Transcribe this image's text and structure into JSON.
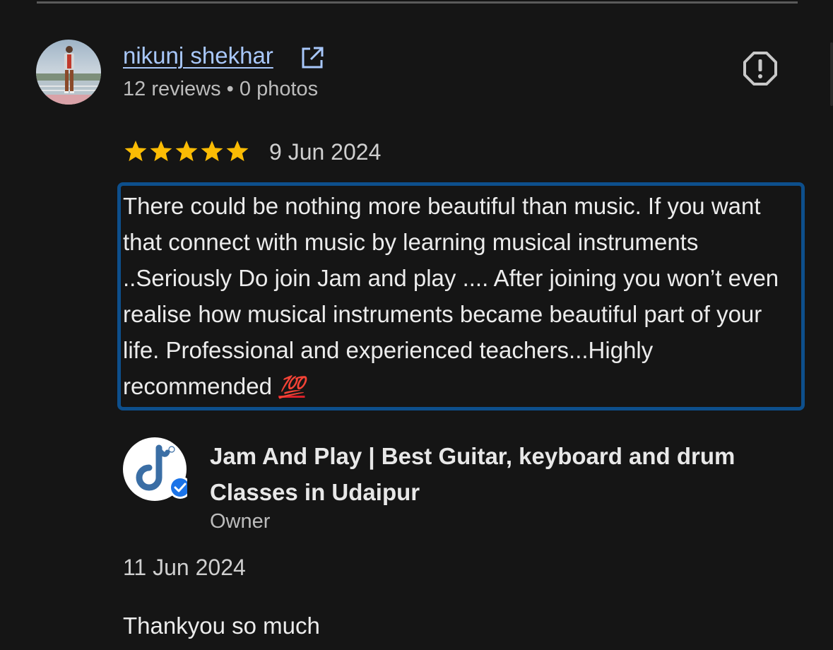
{
  "review": {
    "reviewer_name": "nikunj shekhar",
    "reviewer_meta": "12 reviews • 0 photos",
    "rating": 5,
    "date": "9 Jun 2024",
    "text": "There could be nothing more beautiful than music. If you want that connect with music by learning musical instruments ..Seriously Do join Jam and play .... After joining you won’t even realise how musical instruments became beautiful part of your life. Professional and experienced teachers...Highly recommended",
    "emoji": "💯",
    "icons": {
      "external_link": "external-link-icon",
      "report": "report-icon",
      "star": "star-icon"
    }
  },
  "owner_response": {
    "business_name": "Jam And Play | Best Guitar, keyboard and drum Classes in Udaipur",
    "role": "Owner",
    "date": "11 Jun 2024",
    "reply_text": "Thankyou so much"
  },
  "colors": {
    "background": "#151515",
    "link": "#a8c7fa",
    "star": "#fbbc04",
    "highlight_border": "#0d4f8c",
    "verified_badge": "#1a73e8"
  }
}
